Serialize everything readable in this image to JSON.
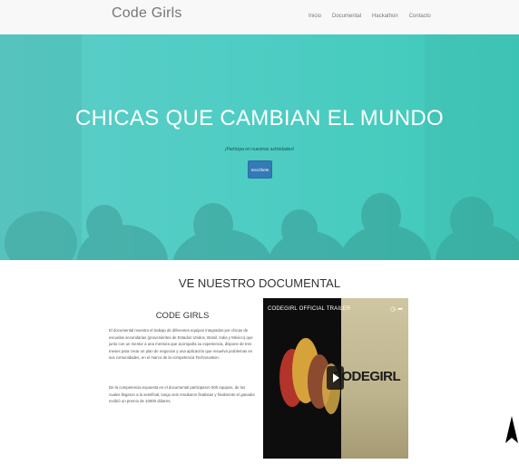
{
  "navbar": {
    "brand": "Code Girls",
    "links": [
      "Inicio",
      "Documental",
      "Hackathon",
      "Contacto"
    ]
  },
  "hero": {
    "title": "CHICAS QUE CAMBIAN EL MUNDO",
    "subtitle": "¡Participa en nuestras actividades!",
    "button": "Inscríbete"
  },
  "documentary": {
    "section_title": "VE NUESTRO DOCUMENTAL",
    "heading": "CODE GIRLS",
    "paragraph1": "El documental muestra el trabajo de diferentes equipos integrados por chicas de escuelas secundarias (provenientes de Estados Unidos, Brasil, India y México) que junto con un mentor a una mentora que acompaña su experiencia, dispone de tres meses para crear un plan de negocios y una aplicación que resuelva problemas en sus comunidades, en el marco de la competencia Technovation.",
    "paragraph2": "De la competencia expuesta en el documental participaron 500 equipos, de los cuales llegaron a la semifinal, luego seis resultaron finalistas y finalmente el ganador recibió un premio de 10000 dólares."
  },
  "video": {
    "title": "CODEGIRL OFFICIAL TRAILER",
    "brand": "CODEGIRL"
  },
  "colors": {
    "hero_teal": "#4fcdc4",
    "button_blue": "#337ab7"
  }
}
